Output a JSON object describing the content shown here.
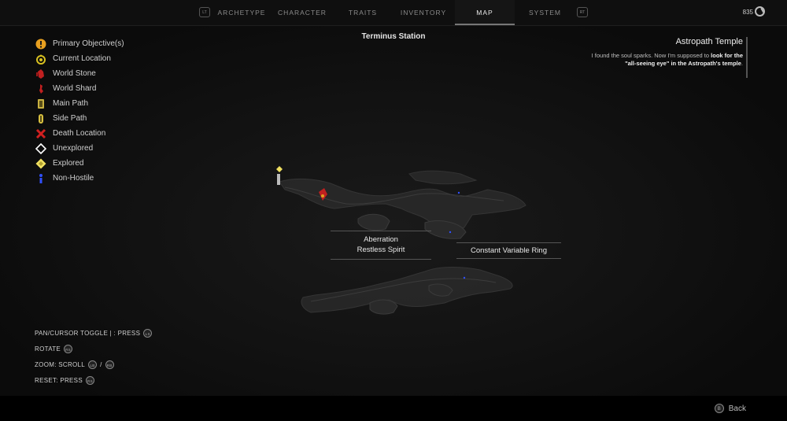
{
  "nav": {
    "left_key": "LT",
    "right_key": "RT",
    "tabs": [
      {
        "label": "ARCHETYPE"
      },
      {
        "label": "CHARACTER"
      },
      {
        "label": "TRAITS"
      },
      {
        "label": "INVENTORY"
      },
      {
        "label": "MAP",
        "active": true
      },
      {
        "label": "SYSTEM"
      }
    ]
  },
  "currency": {
    "amount": "835",
    "icon": "scrap-currency-icon"
  },
  "map": {
    "title": "Terminus Station",
    "labels": [
      {
        "lines": [
          "Aberration",
          "Restless Spirit"
        ]
      },
      {
        "lines": [
          "Constant Variable Ring"
        ]
      }
    ]
  },
  "legend": [
    {
      "label": "Primary Objective(s)",
      "icon": "primary-objective-icon",
      "color": "#e8a020"
    },
    {
      "label": "Current Location",
      "icon": "current-location-icon",
      "color": "#d8c020"
    },
    {
      "label": "World Stone",
      "icon": "world-stone-icon",
      "color": "#c02020"
    },
    {
      "label": "World Shard",
      "icon": "world-shard-icon",
      "color": "#c02020"
    },
    {
      "label": "Main Path",
      "icon": "main-path-icon",
      "color": "#c8b040"
    },
    {
      "label": "Side Path",
      "icon": "side-path-icon",
      "color": "#d8c040"
    },
    {
      "label": "Death Location",
      "icon": "death-location-icon",
      "color": "#d02020"
    },
    {
      "label": "Unexplored",
      "icon": "unexplored-icon",
      "color": "#ffffff"
    },
    {
      "label": "Explored",
      "icon": "explored-icon",
      "color": "#f0e060"
    },
    {
      "label": "Non-Hostile",
      "icon": "non-hostile-icon",
      "color": "#3050ff"
    }
  ],
  "objective": {
    "title": "Astropath Temple",
    "text_plain": "I found the soul sparks. Now I'm supposed to",
    "text_bold": "look for the \"all-seeing eye\" in the Astropath's temple",
    "text_end": "."
  },
  "controls": {
    "pan_label": "PAN/CURSOR TOGGLE | : PRESS",
    "pan_button": "LS",
    "rotate_label": "ROTATE",
    "rotate_button": "RS",
    "zoom_label": "ZOOM: SCROLL",
    "zoom_button_1": "LB",
    "zoom_sep": "/",
    "zoom_button_2": "RB",
    "reset_label": "RESET: PRESS",
    "reset_button": "RS"
  },
  "back": {
    "button": "B",
    "label": "Back"
  }
}
